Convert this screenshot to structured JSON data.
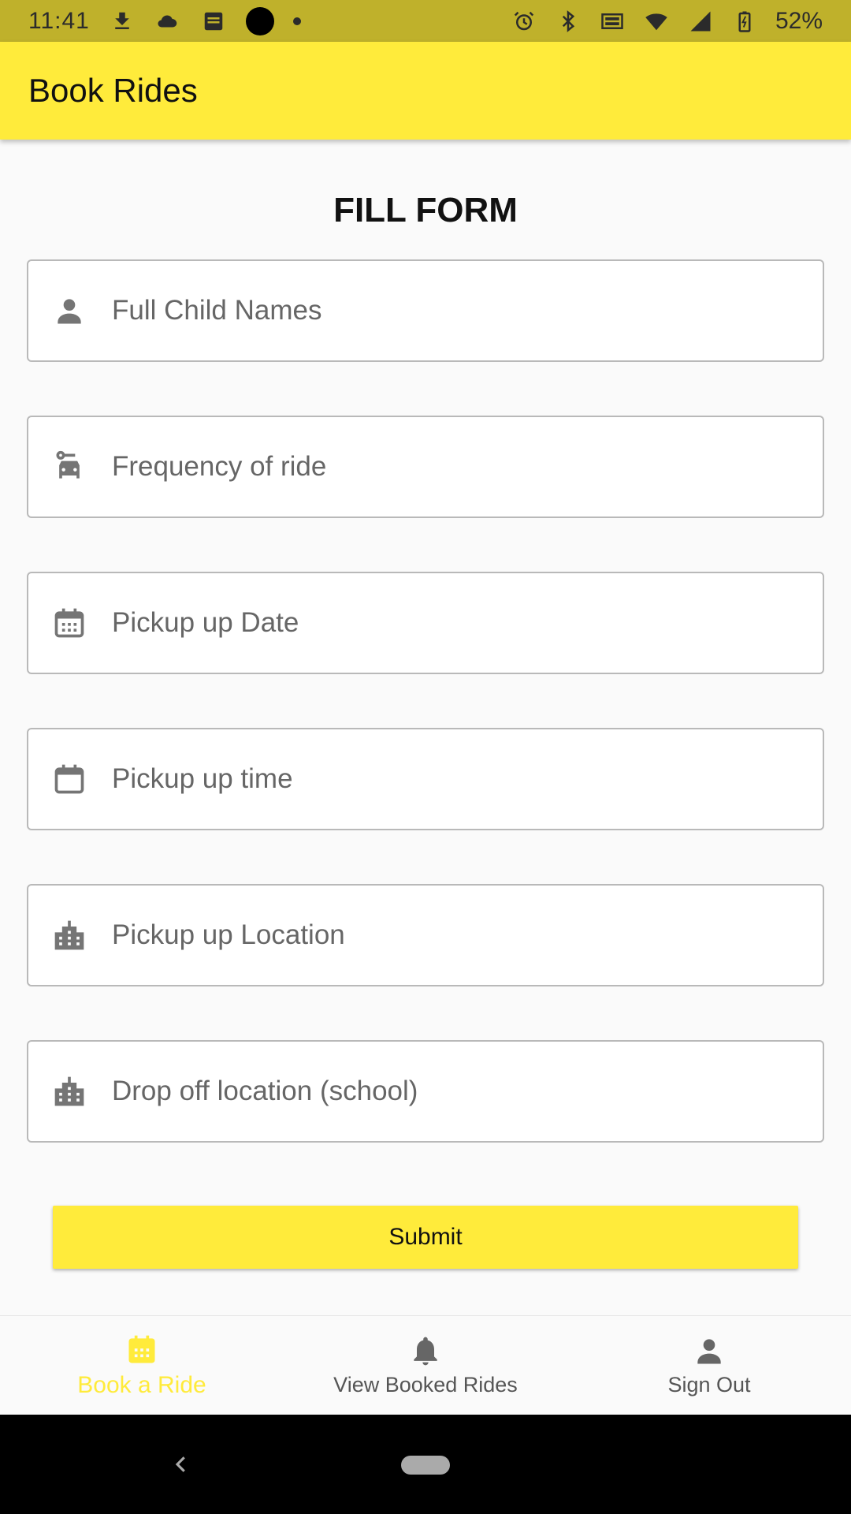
{
  "status_bar": {
    "time": "11:41",
    "battery": "52%",
    "icons": [
      "download-icon",
      "cloud-icon",
      "bible-icon",
      "record-icon",
      "dot-icon",
      "alarm-icon",
      "bluetooth-icon",
      "volte-icon",
      "wifi-icon",
      "signal-icon",
      "battery-icon"
    ]
  },
  "app_bar": {
    "title": "Book Rides"
  },
  "form": {
    "title": "FILL FORM",
    "fields": [
      {
        "placeholder": "Full Child Names",
        "icon": "person-icon"
      },
      {
        "placeholder": "Frequency of ride",
        "icon": "car-icon"
      },
      {
        "placeholder": "Pickup up Date",
        "icon": "calendar-icon"
      },
      {
        "placeholder": "Pickup up time",
        "icon": "calendar-blank-icon"
      },
      {
        "placeholder": "Pickup up Location",
        "icon": "building-icon"
      },
      {
        "placeholder": "Drop off location (school)",
        "icon": "building-icon"
      }
    ],
    "submit_label": "Submit"
  },
  "bottom_nav": {
    "items": [
      {
        "label": "Book a Ride",
        "icon": "calendar-icon",
        "active": true
      },
      {
        "label": "View Booked Rides",
        "icon": "bell-icon",
        "active": false
      },
      {
        "label": "Sign Out",
        "icon": "person-icon",
        "active": false
      }
    ]
  },
  "colors": {
    "status_bar": "#bfb12b",
    "accent": "#ffeb3b",
    "icon_gray": "#757575"
  }
}
